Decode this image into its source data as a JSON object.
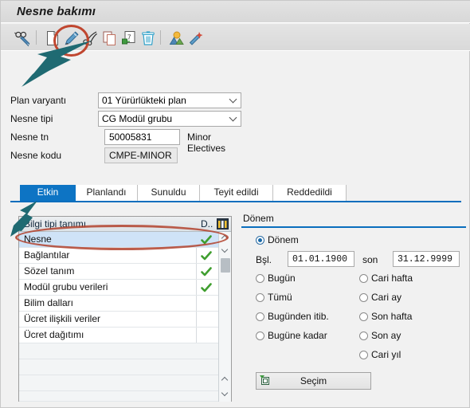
{
  "window": {
    "title": "Nesne bakımı"
  },
  "toolbar": {
    "icons": [
      {
        "name": "display-glasses-pen-icon",
        "label": "Göster"
      },
      {
        "name": "create-document-icon",
        "label": "Yeni"
      },
      {
        "name": "edit-pencil-icon",
        "label": "Değiştir"
      },
      {
        "name": "delimit-scissors-icon",
        "label": "Sınırla"
      },
      {
        "name": "copy-icon",
        "label": "Kopyala"
      },
      {
        "name": "transport-icon",
        "label": "Aktar"
      },
      {
        "name": "delete-trash-icon",
        "label": "Sil"
      },
      {
        "name": "org-structure-icon",
        "label": "Yapı"
      },
      {
        "name": "magic-wand-icon",
        "label": "Sihirbaz"
      }
    ]
  },
  "form": {
    "plan_variant": {
      "label": "Plan varyantı",
      "value": "01 Yürürlükteki plan"
    },
    "object_type": {
      "label": "Nesne tipi",
      "value": "CG Modül grubu"
    },
    "object_id": {
      "label": "Nesne tn",
      "value": "50005831",
      "description": "Minor Electives"
    },
    "object_code": {
      "label": "Nesne kodu",
      "value": "CMPE-MINOR"
    }
  },
  "tabs": [
    {
      "label": "Etkin",
      "active": true
    },
    {
      "label": "Planlandı",
      "active": false
    },
    {
      "label": "Sunuldu",
      "active": false
    },
    {
      "label": "Teyit edildi",
      "active": false
    },
    {
      "label": "Reddedildi",
      "active": false
    }
  ],
  "table": {
    "headers": {
      "name": "Bilgi tipi tanımı",
      "d": "D..",
      "grid_icon": "table-settings-icon"
    },
    "rows": [
      {
        "name": "Nesne",
        "checked": true,
        "selected": true
      },
      {
        "name": "Bağlantılar",
        "checked": true,
        "selected": false
      },
      {
        "name": "Sözel tanım",
        "checked": true,
        "selected": false
      },
      {
        "name": "Modül grubu verileri",
        "checked": true,
        "selected": false
      },
      {
        "name": "Bilim dalları",
        "checked": false,
        "selected": false
      },
      {
        "name": "Ücret ilişkili veriler",
        "checked": false,
        "selected": false
      },
      {
        "name": "Ücret dağıtımı",
        "checked": false,
        "selected": false
      },
      {
        "name": "",
        "checked": false,
        "selected": false
      },
      {
        "name": "",
        "checked": false,
        "selected": false
      },
      {
        "name": "",
        "checked": false,
        "selected": false
      },
      {
        "name": "",
        "checked": false,
        "selected": false
      }
    ]
  },
  "period_panel": {
    "title": "Dönem",
    "options_left": [
      {
        "label": "Dönem",
        "selected": true
      },
      {
        "label": "Bugün",
        "selected": false
      },
      {
        "label": "Tümü",
        "selected": false
      },
      {
        "label": "Bugünden itib.",
        "selected": false
      },
      {
        "label": "Bugüne kadar",
        "selected": false
      }
    ],
    "options_right": [
      {
        "label": "Cari hafta",
        "selected": false
      },
      {
        "label": "Cari ay",
        "selected": false
      },
      {
        "label": "Son hafta",
        "selected": false
      },
      {
        "label": "Son ay",
        "selected": false
      },
      {
        "label": "Cari yıl",
        "selected": false
      }
    ],
    "start": {
      "label": "Bşl.",
      "value": "01.01.1900"
    },
    "end": {
      "label": "son",
      "value": "31.12.9999"
    },
    "select_button": {
      "label": "Seçim",
      "icon": "selection-icon"
    }
  },
  "annotations": {
    "accent_color": "#b2422d",
    "arrow_color": "#1f6a72",
    "highlights": [
      {
        "name": "edit-pencil-highlight"
      },
      {
        "name": "nesne-row-highlight"
      }
    ],
    "arrows": [
      {
        "name": "arrow-to-edit-pencil"
      },
      {
        "name": "arrow-to-nesne-row"
      }
    ]
  }
}
